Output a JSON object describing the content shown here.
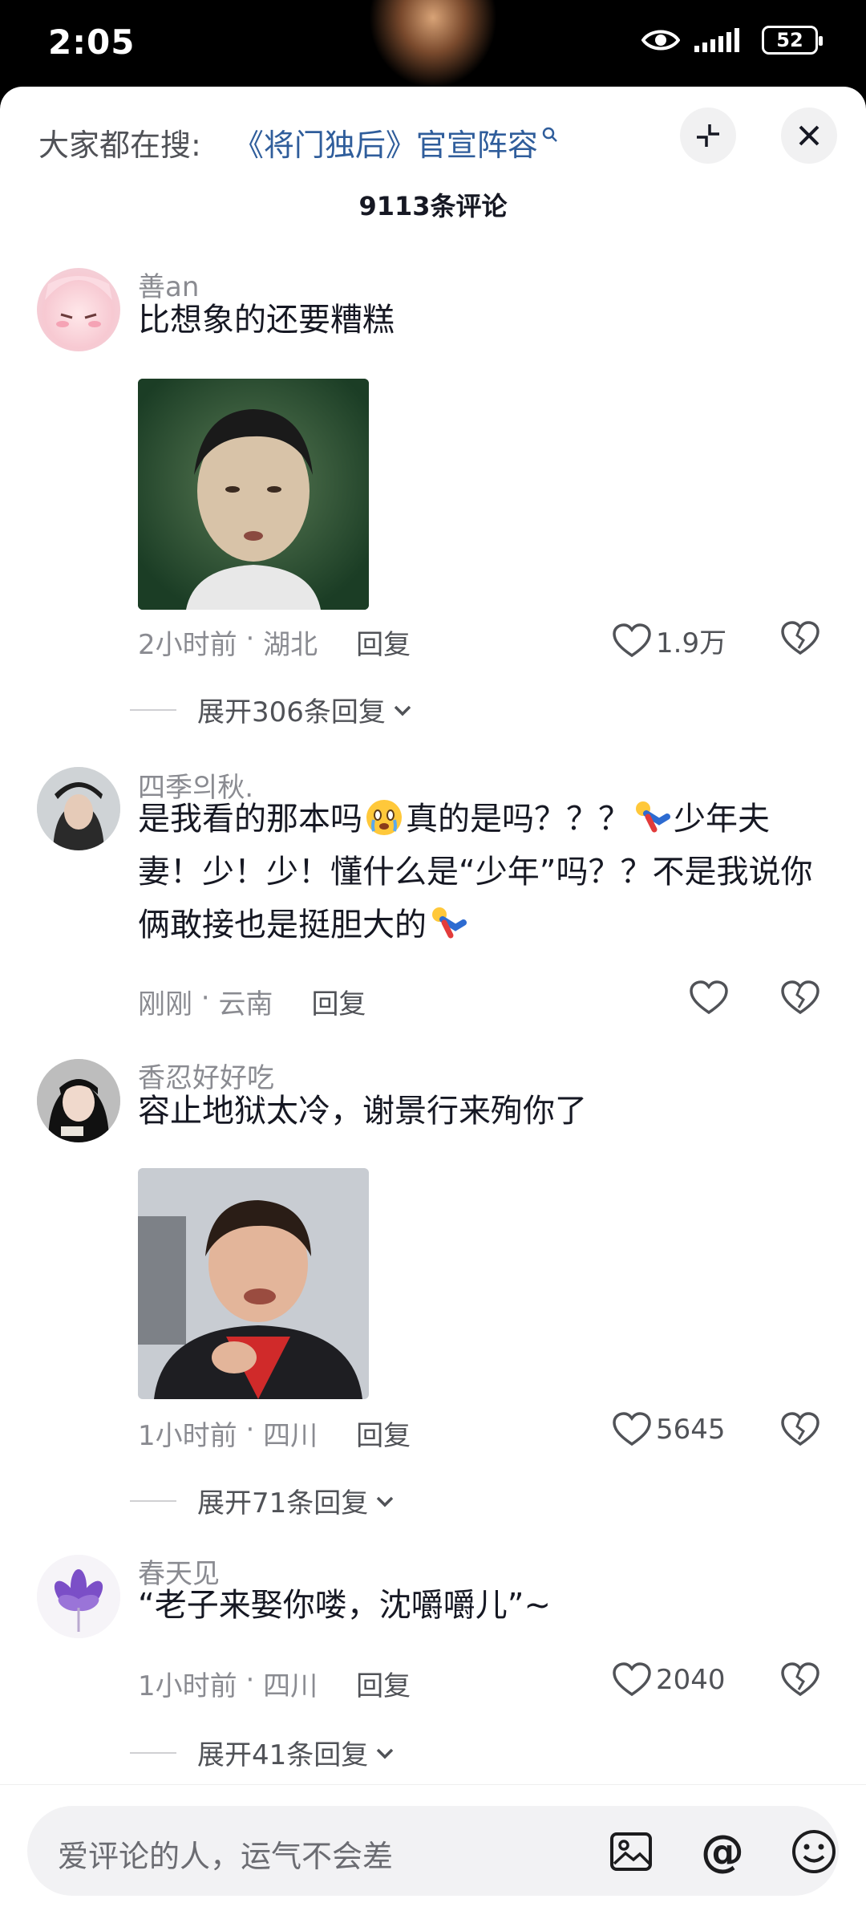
{
  "status_bar": {
    "time": "2:05",
    "battery": "52"
  },
  "header": {
    "search_prefix": "大家都在搜:",
    "search_query": "《将门独后》官宣阵容",
    "comment_count": "9113条评论"
  },
  "comments": [
    {
      "username": "善an",
      "text": "比想象的还要糟糕",
      "time": "2小时前",
      "location": "湖北",
      "reply_label": "回复",
      "likes": "1.9万",
      "expand_label": "展开306条回复"
    },
    {
      "username": "四季의秋.",
      "text_part1": "是我看的那本吗",
      "text_part2": "真的是吗？？？",
      "text_part3": "少年夫妻！少！少！懂什么是“少年”吗？？不是我说你俩敢接也是挺胆大的",
      "time": "刚刚",
      "location": "云南",
      "reply_label": "回复",
      "likes": ""
    },
    {
      "username": "香忍好好吃",
      "text": "容止地狱太冷，谢景行来殉你了",
      "time": "1小时前",
      "location": "四川",
      "reply_label": "回复",
      "likes": "5645",
      "expand_label": "展开71条回复"
    },
    {
      "username": "春天见",
      "text": "“老子来娶你喽，沈嚼嚼儿”~",
      "time": "1小时前",
      "location": "四川",
      "reply_label": "回复",
      "likes": "2040",
      "expand_label": "展开41条回复"
    }
  ],
  "input": {
    "placeholder": "爱评论的人，运气不会差"
  },
  "icons": {
    "eye": "eye-icon",
    "signal": "signal-icon",
    "collapse": "collapse-icon",
    "close": "close-icon",
    "like": "heart-icon",
    "dislike": "broken-heart-icon",
    "image": "image-icon",
    "at": "at-icon",
    "emoji": "emoji-icon"
  },
  "colors": {
    "link": "#2f5d9b",
    "muted": "#8a8b91",
    "text": "#161823"
  }
}
